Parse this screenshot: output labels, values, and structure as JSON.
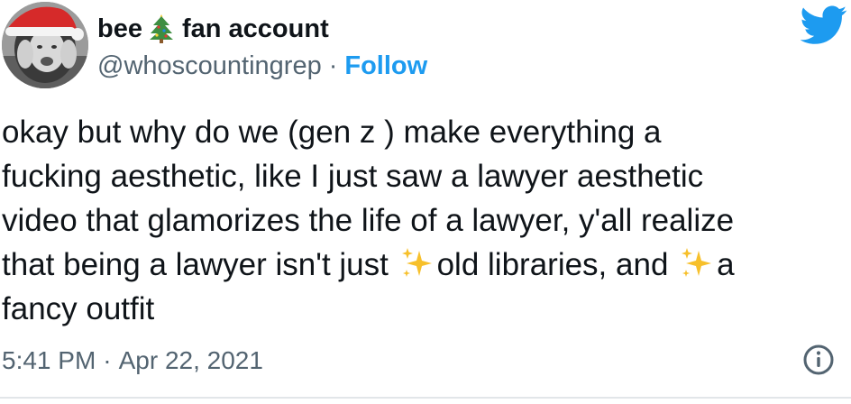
{
  "tweet": {
    "display_name_part1": "bee",
    "display_name_emoji": "christmas-tree-emoji",
    "display_name_part2": "fan account",
    "handle": "@whoscountingrep",
    "separator": "·",
    "follow_label": "Follow",
    "body_lines": [
      "okay but why do we (gen z ) make everything a",
      "fucking aesthetic, like I just saw a lawyer aesthetic",
      "video that glamorizes the life of a lawyer, y'all realize",
      "that being a lawyer isn't just",
      "old libraries, and",
      "a",
      "fancy outfit"
    ],
    "time": "5:41 PM",
    "date": "Apr 22, 2021"
  },
  "icons": {
    "brand": "twitter-bird-icon",
    "info": "info-icon",
    "sparkles": "sparkles-emoji"
  },
  "colors": {
    "accent": "#1d9bf0",
    "text": "#0f1419",
    "secondary": "#536471",
    "divider": "#e2e6e9"
  }
}
